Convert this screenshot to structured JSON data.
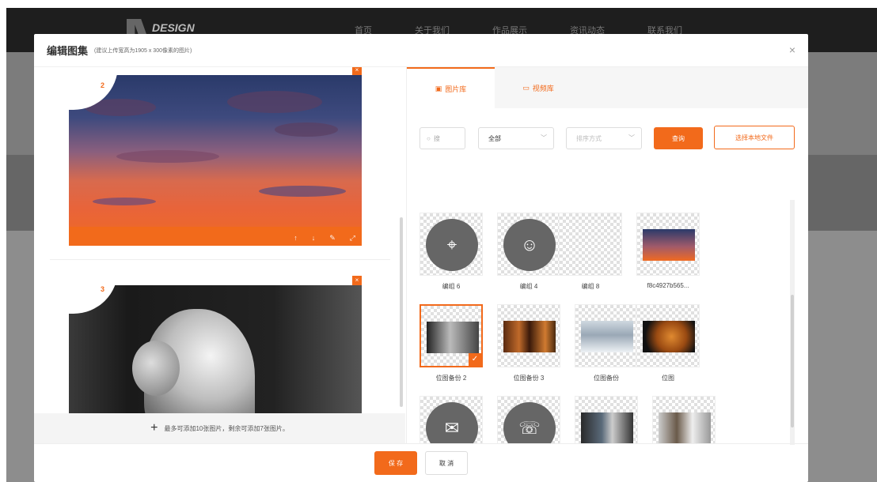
{
  "site": {
    "logo_text": "DESIGN",
    "nav": [
      "首页",
      "关于我们",
      "作品展示",
      "资讯动态",
      "联系我们"
    ]
  },
  "modal": {
    "title": "编辑图集",
    "subtitle": "(建议上传宽高为1905 x 300像素的图片)",
    "close": "×"
  },
  "editor": {
    "cards": [
      {
        "index": "2",
        "image": "sunset-sky"
      },
      {
        "index": "3",
        "image": "statue-bust"
      }
    ],
    "card_tools": [
      "↑",
      "↓",
      "✎",
      "⤢"
    ],
    "footer_tip": "最多可添加10张图片，剩余可添加7张图片。",
    "add_icon": "+"
  },
  "library": {
    "tabs": [
      {
        "label": "图片库",
        "icon": "image-icon",
        "active": true
      },
      {
        "label": "视频库",
        "icon": "video-icon",
        "active": false
      }
    ],
    "search_placeholder": "搜",
    "filter_all": "全部",
    "sort_placeholder": "排序方式",
    "query_button": "查询",
    "local_button": "选择本地文件",
    "items": [
      {
        "label": "编组 6",
        "type": "icon",
        "icon": "location-pin-icon"
      },
      {
        "label": "编组 4",
        "type": "icon",
        "icon": "wechat-icon"
      },
      {
        "label": "编组 8",
        "type": "blank"
      },
      {
        "label": "f8c4927b565...",
        "type": "photo",
        "photo": "sky"
      },
      {
        "label": "位图备份 2",
        "type": "photo",
        "photo": "bust",
        "selected": true
      },
      {
        "label": "位图备份 3",
        "type": "photo",
        "photo": "forest"
      },
      {
        "label": "位图备份",
        "type": "photo",
        "photo": "snow"
      },
      {
        "label": "位图",
        "type": "photo",
        "photo": "tiger"
      },
      {
        "label": "",
        "type": "icon",
        "icon": "mail-icon"
      },
      {
        "label": "",
        "type": "icon",
        "icon": "phone-icon"
      },
      {
        "label": "",
        "type": "photo",
        "photo": "room"
      },
      {
        "label": "",
        "type": "photo",
        "photo": "room2"
      }
    ]
  },
  "footer": {
    "save": "保 存",
    "cancel": "取 消"
  },
  "colors": {
    "accent": "#f26a1b"
  }
}
